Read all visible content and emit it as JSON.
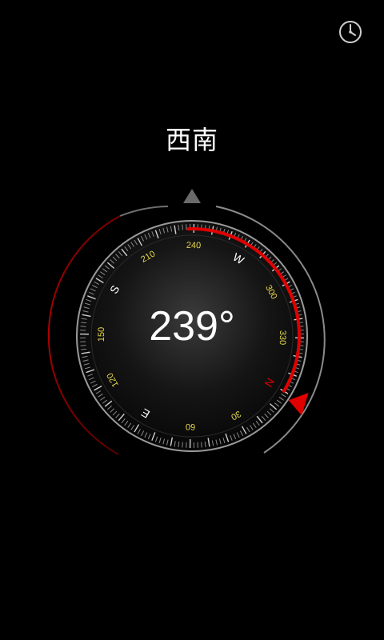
{
  "direction_label": "西南",
  "heading_text": "239°",
  "heading_value": 239,
  "dial": {
    "cardinals": [
      {
        "label": "S",
        "deg": 180
      },
      {
        "label": "W",
        "deg": 270
      },
      {
        "label": "N",
        "deg": 0
      },
      {
        "label": "E",
        "deg": 90
      }
    ],
    "numbers": [
      {
        "label": "210",
        "deg": 210
      },
      {
        "label": "240",
        "deg": 240
      },
      {
        "label": "300",
        "deg": 300
      },
      {
        "label": "330",
        "deg": 330
      },
      {
        "label": "30",
        "deg": 30
      },
      {
        "label": "60",
        "deg": 60
      },
      {
        "label": "120",
        "deg": 120
      },
      {
        "label": "150",
        "deg": 150
      }
    ]
  },
  "colors": {
    "accent_red": "#e00000",
    "number_yellow": "#e8d84a",
    "cardinal_white": "#ffffff",
    "ring_gray": "#777777",
    "background": "#000000"
  },
  "icons": {
    "history": "clock-icon"
  }
}
